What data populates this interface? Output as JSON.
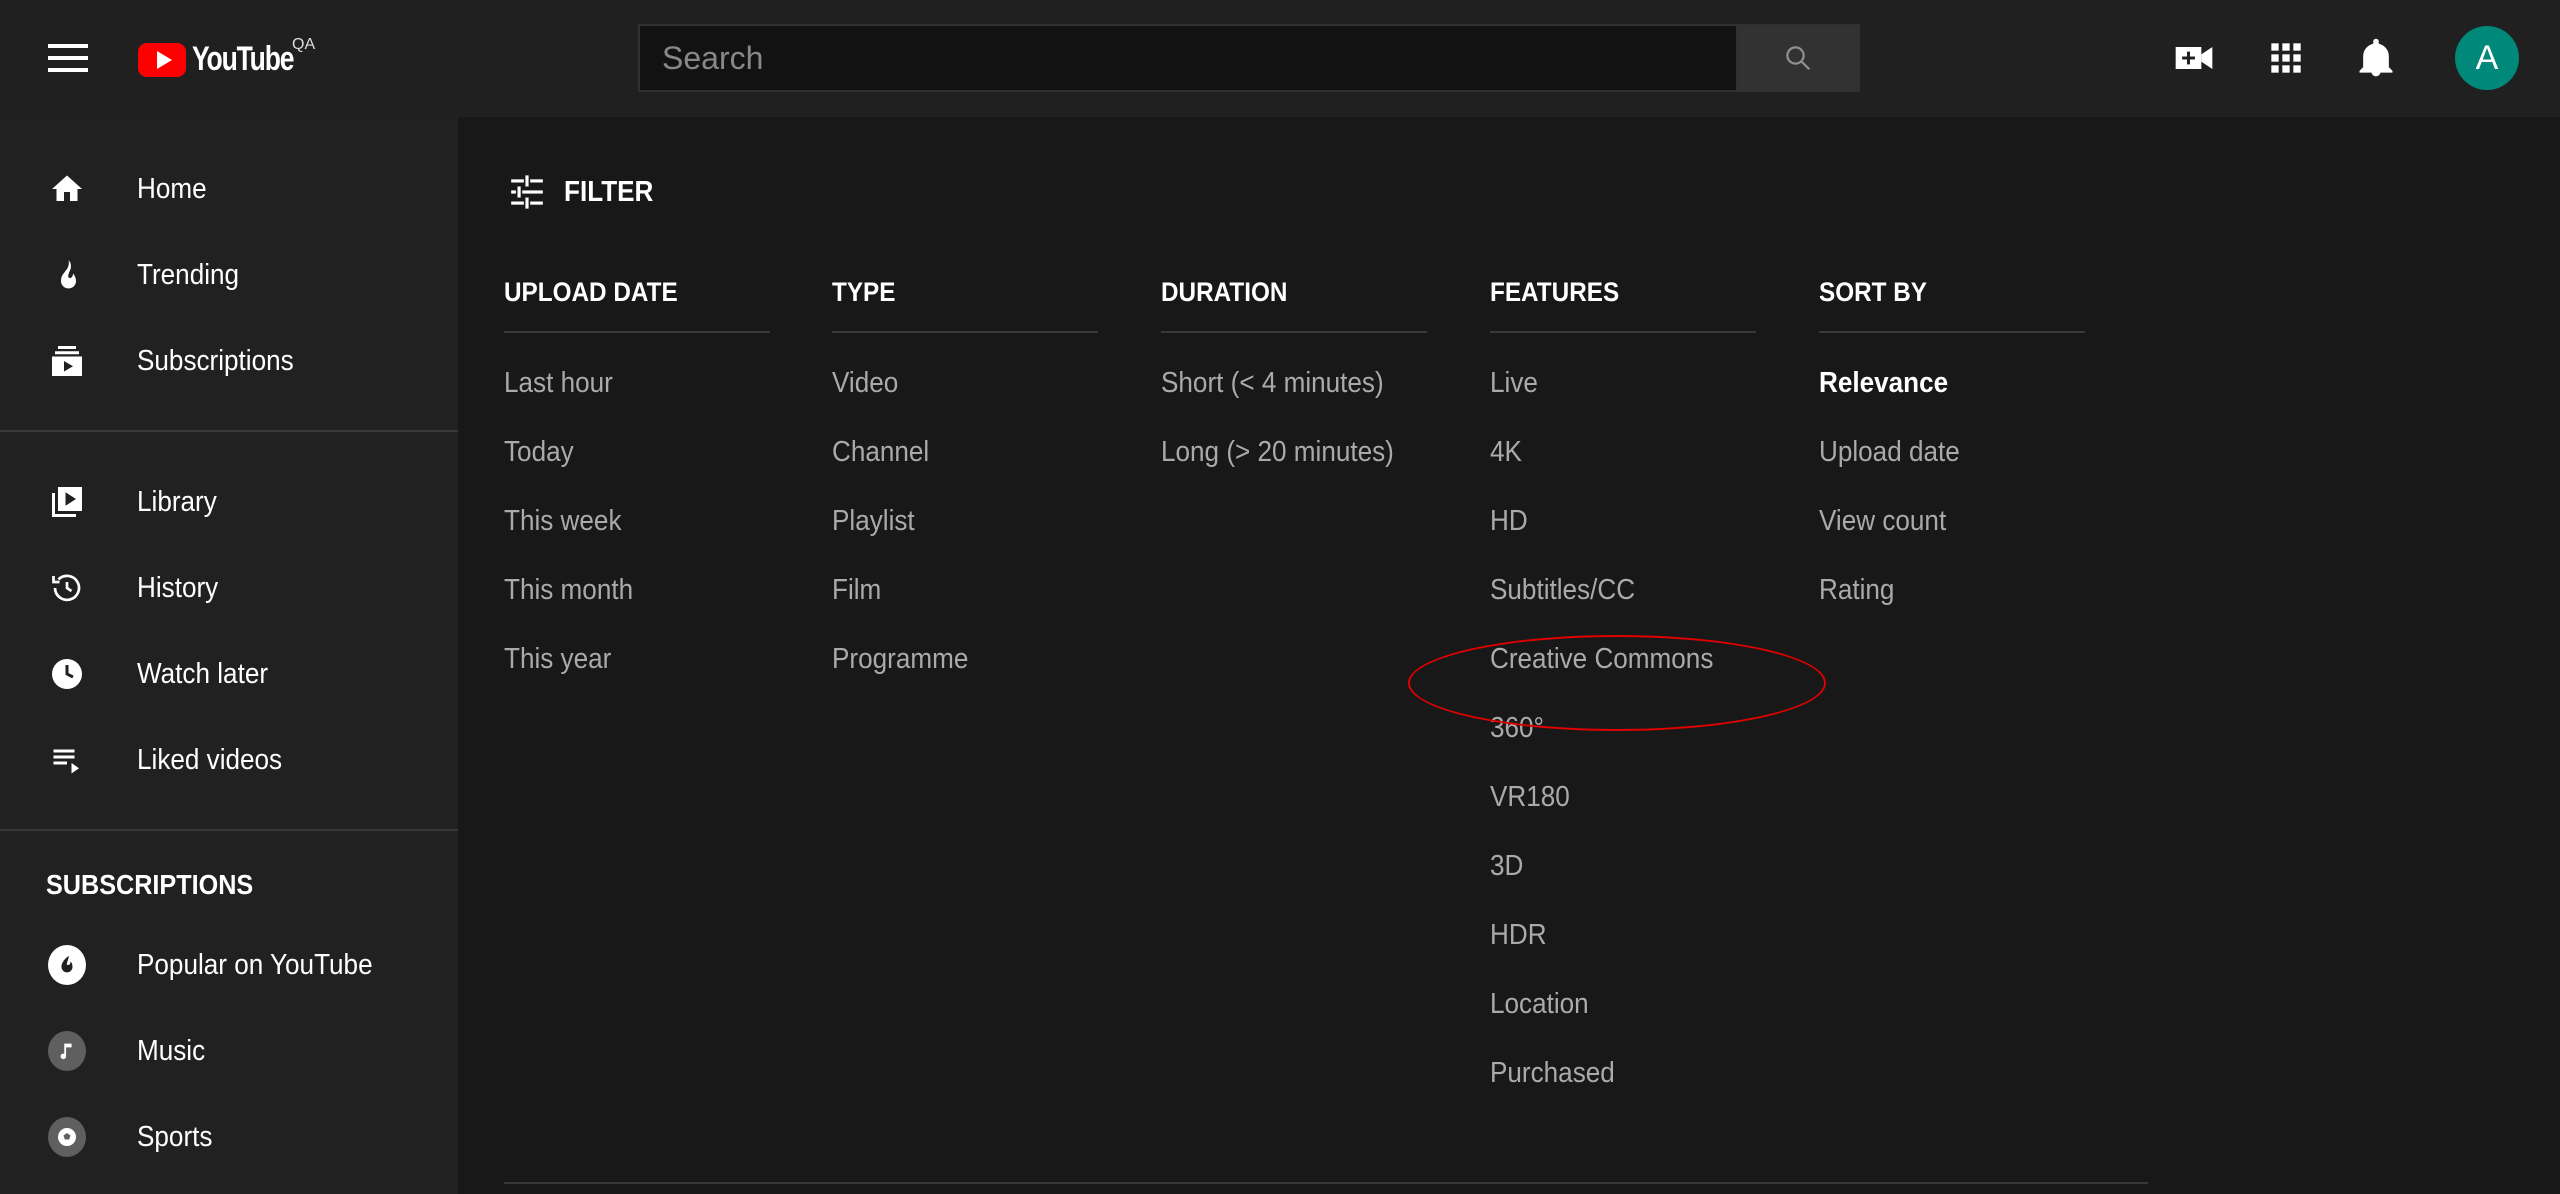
{
  "header": {
    "logo_text": "YouTube",
    "logo_badge": "QA",
    "search_placeholder": "Search",
    "avatar_letter": "A"
  },
  "sidebar": {
    "items_main": [
      {
        "label": "Home",
        "icon": "home-icon"
      },
      {
        "label": "Trending",
        "icon": "flame-icon"
      },
      {
        "label": "Subscriptions",
        "icon": "subscriptions-icon"
      }
    ],
    "items_library": [
      {
        "label": "Library",
        "icon": "library-icon"
      },
      {
        "label": "History",
        "icon": "history-icon"
      },
      {
        "label": "Watch later",
        "icon": "clock-icon"
      },
      {
        "label": "Liked videos",
        "icon": "playlist-icon"
      }
    ],
    "subscriptions_heading": "SUBSCRIPTIONS",
    "subscriptions": [
      {
        "label": "Popular on YouTube",
        "icon": "popular-icon"
      },
      {
        "label": "Music",
        "icon": "music-icon"
      },
      {
        "label": "Sports",
        "icon": "sports-icon"
      }
    ]
  },
  "filter": {
    "label": "FILTER",
    "columns": [
      {
        "heading": "UPLOAD DATE",
        "options": [
          "Last hour",
          "Today",
          "This week",
          "This month",
          "This year"
        ]
      },
      {
        "heading": "TYPE",
        "options": [
          "Video",
          "Channel",
          "Playlist",
          "Film",
          "Programme"
        ]
      },
      {
        "heading": "DURATION",
        "options": [
          "Short (< 4 minutes)",
          "Long (> 20 minutes)"
        ]
      },
      {
        "heading": "FEATURES",
        "options": [
          "Live",
          "4K",
          "HD",
          "Subtitles/CC",
          "Creative Commons",
          "360°",
          "VR180",
          "3D",
          "HDR",
          "Location",
          "Purchased"
        ]
      },
      {
        "heading": "SORT BY",
        "options": [
          "Relevance",
          "Upload date",
          "View count",
          "Rating"
        ],
        "active": "Relevance"
      }
    ]
  },
  "annotation": {
    "highlighted_option": "Creative Commons",
    "color": "#e00000"
  },
  "colors": {
    "topbar": "#202020",
    "sidebar": "#212121",
    "main": "#181818",
    "avatar": "#00897b",
    "logo": "#ff0000"
  }
}
